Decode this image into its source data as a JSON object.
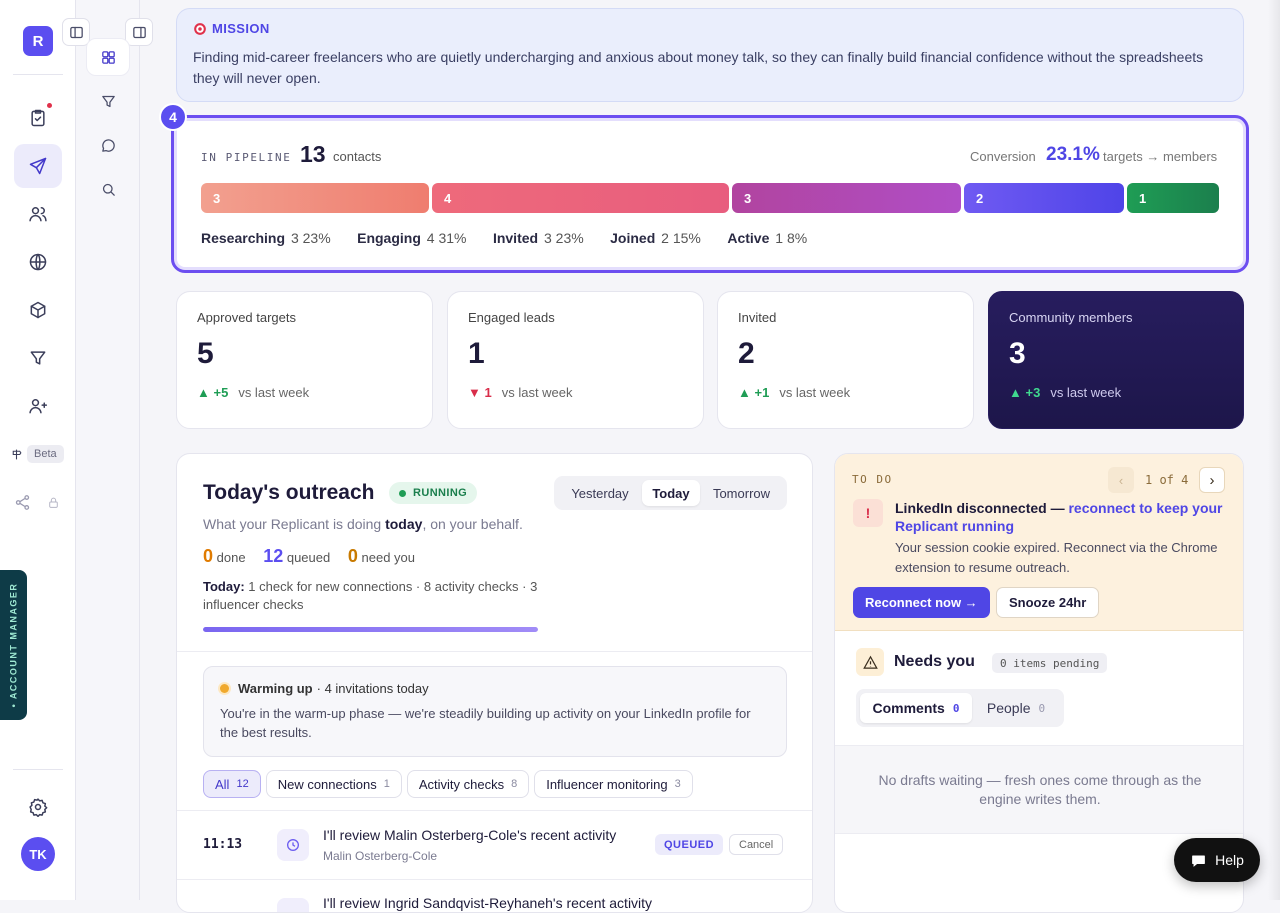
{
  "rail": {
    "avatar_letter": "R",
    "beta_label": "Beta",
    "user_initials": "TK",
    "account_manager_label": "• ACCOUNT MANAGER"
  },
  "mission": {
    "title": "MISSION",
    "text": "Finding mid-career freelancers who are quietly undercharging and anxious about money talk, so they can finally build financial confidence without the spreadsheets they will never open."
  },
  "pipeline": {
    "step": "4",
    "label": "IN PIPELINE",
    "count": "13",
    "unit": "contacts",
    "conversion_label": "Conversion",
    "conversion_value": "23.1%",
    "conversion_note": "targets → members",
    "stages": [
      {
        "name": "Researching",
        "count": "3",
        "pct": "23%",
        "color": "#ef7d6f"
      },
      {
        "name": "Engaging",
        "count": "4",
        "pct": "31%",
        "color": "#e85d7e"
      },
      {
        "name": "Invited",
        "count": "3",
        "pct": "23%",
        "color": "#b44ab8"
      },
      {
        "name": "Joined",
        "count": "2",
        "pct": "15%",
        "color": "#5b4ef0"
      },
      {
        "name": "Active",
        "count": "1",
        "pct": "8%",
        "color": "#1e8f55"
      }
    ]
  },
  "stats": [
    {
      "label": "Approved targets",
      "value": "5",
      "delta": "+5",
      "dir": "up",
      "note": "vs last week"
    },
    {
      "label": "Engaged leads",
      "value": "1",
      "delta": "1",
      "dir": "down",
      "note": "vs last week"
    },
    {
      "label": "Invited",
      "value": "2",
      "delta": "+1",
      "dir": "up",
      "note": "vs last week"
    },
    {
      "label": "Community members",
      "value": "3",
      "delta": "+3",
      "dir": "up",
      "note": "vs last week"
    }
  ],
  "outreach": {
    "title": "Today's outreach",
    "status": "RUNNING",
    "sub_pre": "What your Replicant is doing ",
    "sub_bold": "today",
    "sub_post": ", on your behalf.",
    "day_tabs": [
      "Yesterday",
      "Today",
      "Tomorrow"
    ],
    "active_day": "Today",
    "done_n": "0",
    "done_l": "done",
    "queued_n": "12",
    "queued_l": "queued",
    "need_n": "0",
    "need_l": "need you",
    "summary_label": "Today:",
    "summary": "1 check for new connections · 8 activity checks · 3 influencer checks",
    "progress": 1.0,
    "warm_title": "Warming up",
    "warm_meta": "· 4 invitations today",
    "warm_text": "You're in the warm-up phase — we're steadily building up activity on your LinkedIn profile for the best results.",
    "filters": [
      {
        "label": "All",
        "count": "12"
      },
      {
        "label": "New connections",
        "count": "1"
      },
      {
        "label": "Activity checks",
        "count": "8"
      },
      {
        "label": "Influencer monitoring",
        "count": "3"
      }
    ],
    "rows": [
      {
        "time": "11:13",
        "title": "I'll review Malin Osterberg-Cole's recent activity",
        "person": "Malin Osterberg-Cole",
        "status": "QUEUED",
        "action": "Cancel"
      },
      {
        "time": "",
        "title": "I'll review Ingrid Sandqvist-Reyhaneh's recent activity",
        "person": "",
        "status": "",
        "action": ""
      }
    ]
  },
  "todo": {
    "label": "TO DO",
    "pager": "1 of 4",
    "alert_lead": "LinkedIn disconnected — ",
    "alert_link": "reconnect to keep your Replicant running",
    "alert_text": "Your session cookie expired. Reconnect via the Chrome extension to resume outreach.",
    "primary": "Reconnect now →",
    "secondary": "Snooze 24hr"
  },
  "needs": {
    "title": "Needs you",
    "pending": "0 items pending",
    "tabs": [
      {
        "label": "Comments",
        "count": "0"
      },
      {
        "label": "People",
        "count": "0"
      }
    ],
    "empty": "No drafts waiting — fresh ones come through as the engine writes them."
  },
  "help_label": "Help"
}
